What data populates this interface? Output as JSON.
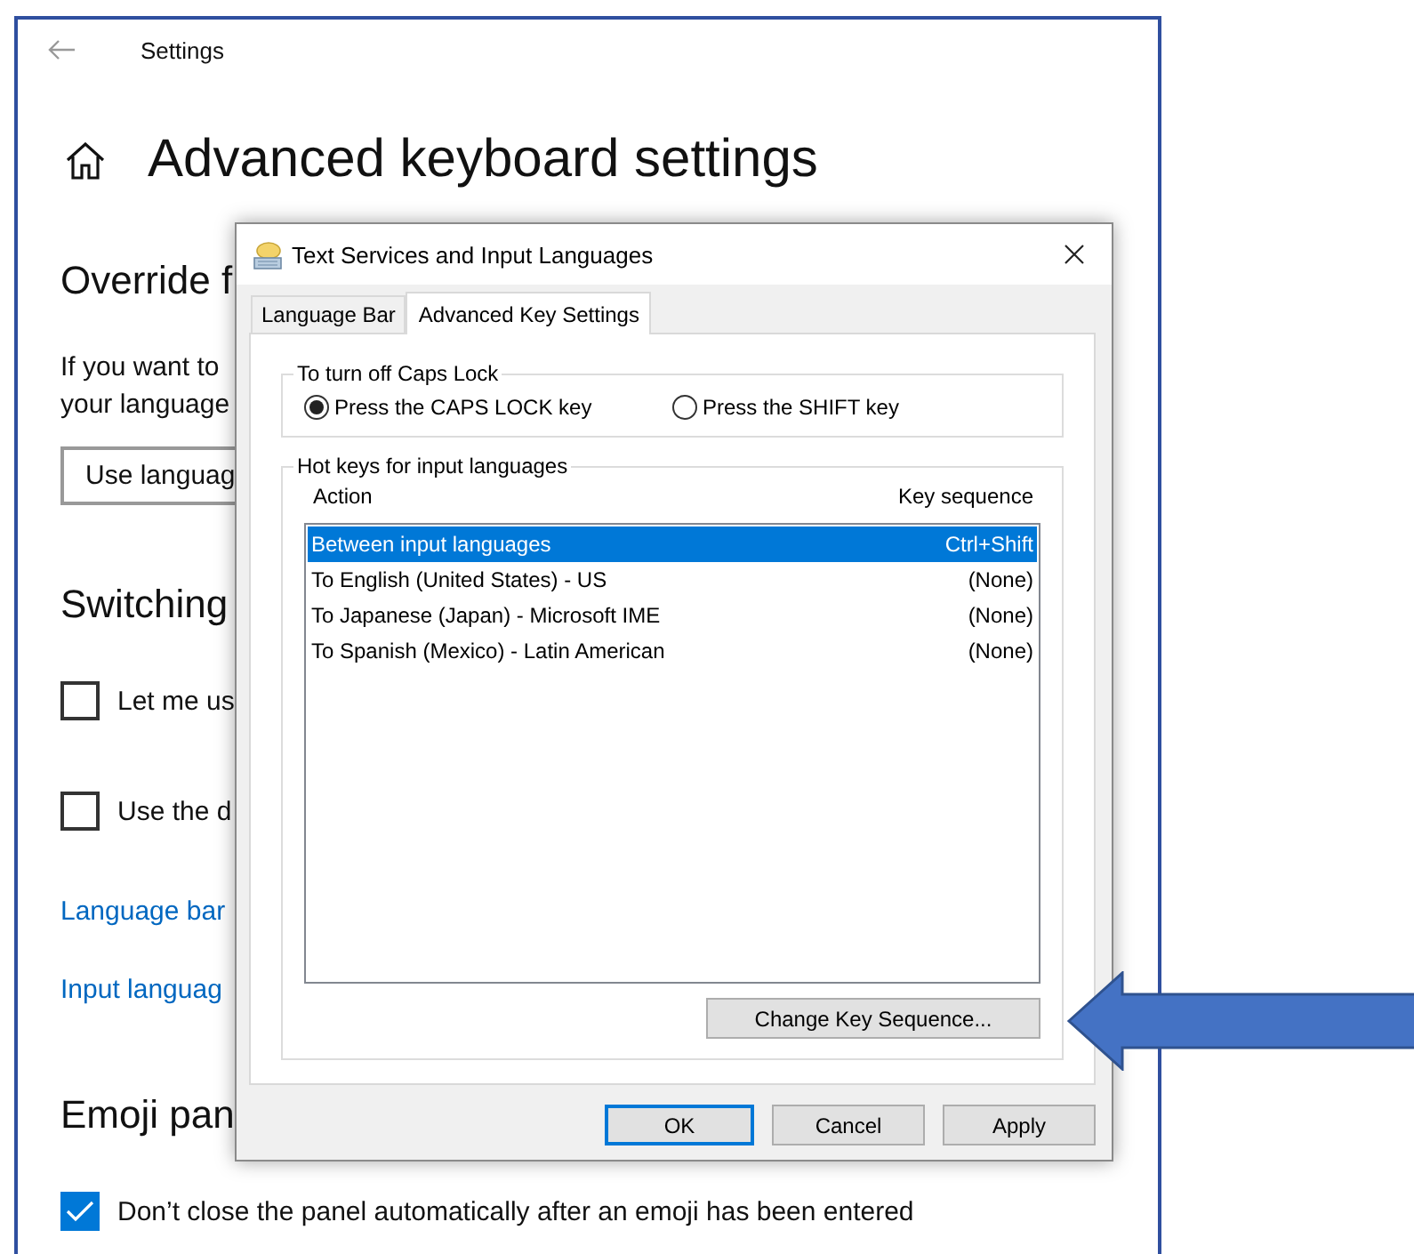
{
  "settings_window": {
    "title": "Settings",
    "heading": "Advanced keyboard settings",
    "override_heading": "Override f",
    "override_text": [
      "If you want to",
      "your language"
    ],
    "dropdown": {
      "value": "Use languag"
    },
    "switching_heading": "Switching",
    "switching_options": [
      {
        "label": "Let me us",
        "checked": false
      },
      {
        "label": "Use the d",
        "checked": false
      }
    ],
    "links": [
      "Language bar",
      "Input languag"
    ],
    "emoji_heading": "Emoji pan",
    "emoji_options": [
      {
        "label": "Don’t close the panel automatically after an emoji has been entered",
        "checked": true
      }
    ]
  },
  "dialog": {
    "title": "Text Services and Input Languages",
    "tabs": [
      {
        "label": "Language Bar",
        "selected": false
      },
      {
        "label": "Advanced Key Settings",
        "selected": true
      }
    ],
    "caps_lock_group": {
      "title": "To turn off Caps Lock",
      "options": [
        {
          "label": "Press the CAPS LOCK key",
          "selected": true
        },
        {
          "label": "Press the SHIFT key",
          "selected": false
        }
      ]
    },
    "hotkeys_group": {
      "title": "Hot keys for input languages",
      "columns": [
        "Action",
        "Key sequence"
      ],
      "rows": [
        {
          "action": "Between input languages",
          "key_sequence": "Ctrl+Shift",
          "selected": true
        },
        {
          "action": "To English (United States) - US",
          "key_sequence": "(None)",
          "selected": false
        },
        {
          "action": "To Japanese (Japan) - Microsoft IME",
          "key_sequence": "(None)",
          "selected": false
        },
        {
          "action": "To Spanish (Mexico) - Latin American",
          "key_sequence": "(None)",
          "selected": false
        }
      ],
      "button": "Change Key Sequence..."
    },
    "buttons": [
      {
        "label": "OK",
        "focused": true
      },
      {
        "label": "Cancel",
        "focused": false
      },
      {
        "label": "Apply",
        "focused": false
      }
    ]
  }
}
